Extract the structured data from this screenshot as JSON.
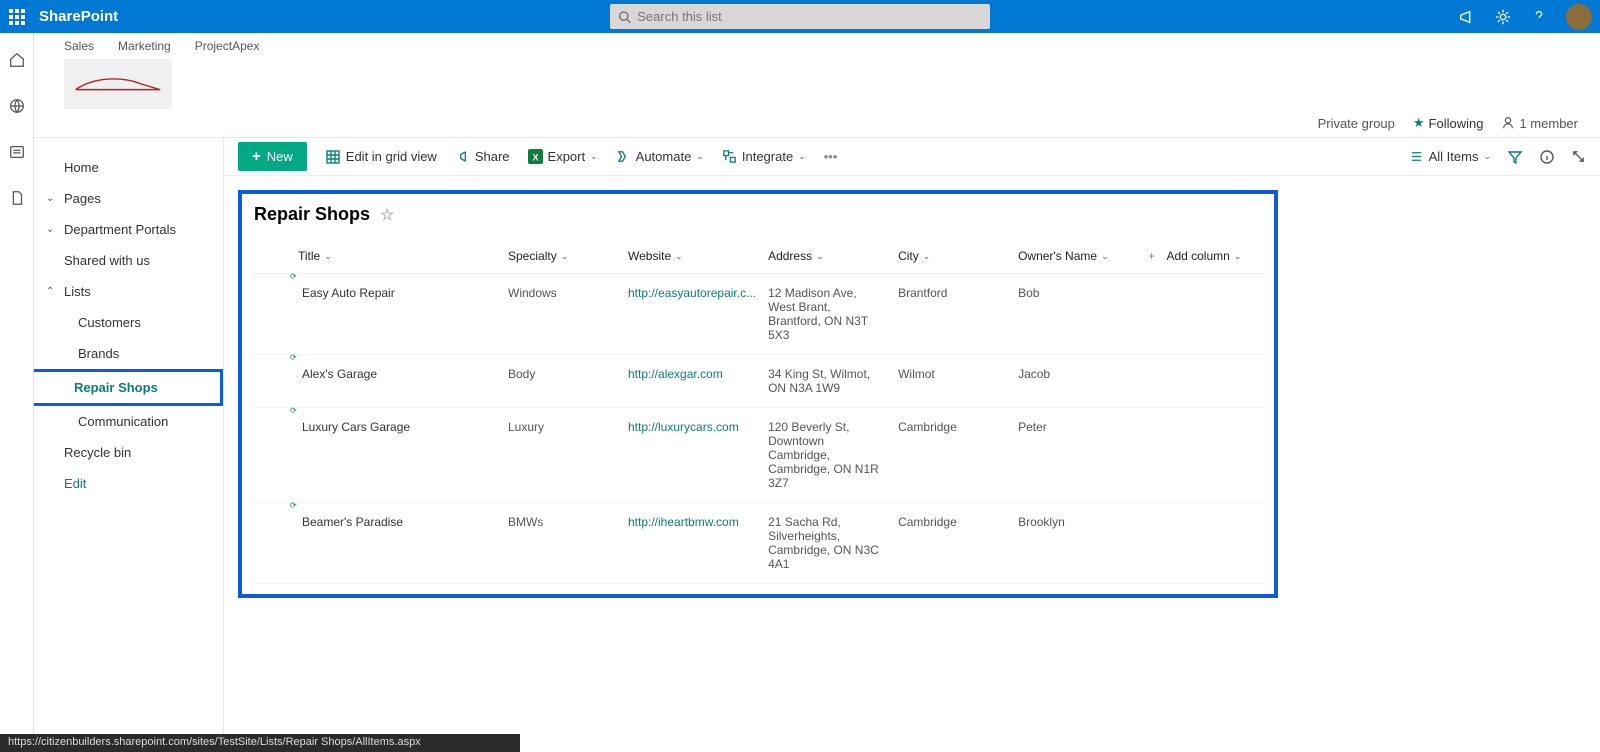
{
  "suite": {
    "brand": "SharePoint",
    "search_placeholder": "Search this list"
  },
  "tabs": [
    "Sales",
    "Marketing",
    "ProjectApex"
  ],
  "siteInfo": {
    "privacy": "Private group",
    "following": "Following",
    "members": "1 member"
  },
  "nav": {
    "home": "Home",
    "pages": "Pages",
    "dept": "Department Portals",
    "shared": "Shared with us",
    "lists": "Lists",
    "customers": "Customers",
    "brands": "Brands",
    "repair": "Repair Shops",
    "comm": "Communication",
    "recycle": "Recycle bin",
    "edit": "Edit"
  },
  "cmd": {
    "new": "New",
    "grid": "Edit in grid view",
    "share": "Share",
    "export": "Export",
    "automate": "Automate",
    "integrate": "Integrate",
    "allitems": "All Items"
  },
  "list": {
    "title": "Repair Shops",
    "addcol": "Add column"
  },
  "cols": {
    "title": "Title",
    "specialty": "Specialty",
    "website": "Website",
    "address": "Address",
    "city": "City",
    "owner": "Owner's Name"
  },
  "rows": [
    {
      "title": "Easy Auto Repair",
      "specialty": "Windows",
      "website": "http://easyautorepair.c...",
      "address": "12 Madison Ave, West Brant, Brantford, ON N3T 5X3",
      "city": "Brantford",
      "owner": "Bob"
    },
    {
      "title": "Alex's Garage",
      "specialty": "Body",
      "website": "http://alexgar.com",
      "address": "34 King St, Wilmot, ON N3A 1W9",
      "city": "Wilmot",
      "owner": "Jacob"
    },
    {
      "title": "Luxury Cars Garage",
      "specialty": "Luxury",
      "website": "http://luxurycars.com",
      "address": "120 Beverly St, Downtown Cambridge, Cambridge, ON N1R 3Z7",
      "city": "Cambridge",
      "owner": "Peter"
    },
    {
      "title": "Beamer's Paradise",
      "specialty": "BMWs",
      "website": "http://iheartbmw.com",
      "address": "21 Sacha Rd, Silverheights, Cambridge, ON N3C 4A1",
      "city": "Cambridge",
      "owner": "Brooklyn"
    }
  ],
  "status": "https://citizenbuilders.sharepoint.com/sites/TestSite/Lists/Repair Shops/AllItems.aspx"
}
